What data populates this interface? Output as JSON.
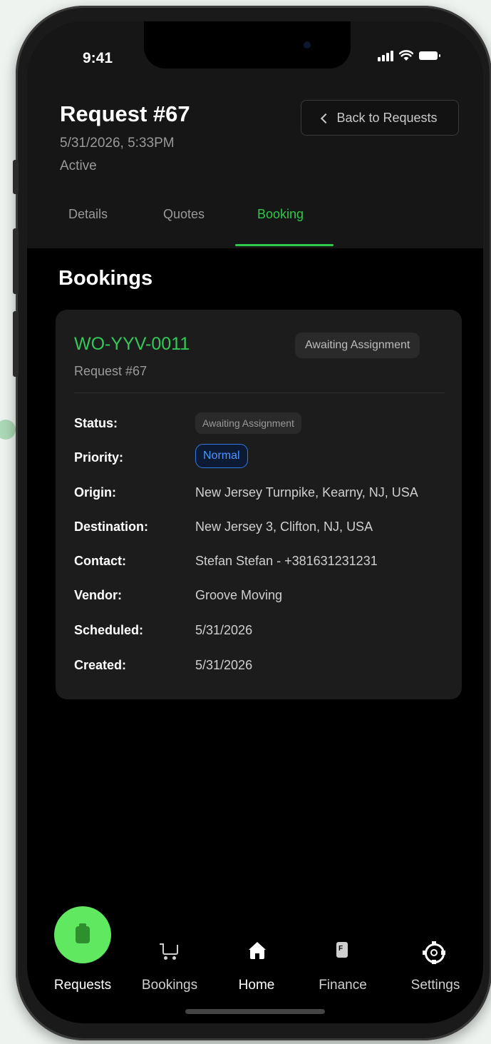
{
  "status_bar": {
    "time": "9:41"
  },
  "header": {
    "title": "Request #67",
    "datetime": "5/31/2026, 5:33PM",
    "status": "Active",
    "back_label": "Back to Requests"
  },
  "tabs": [
    {
      "label": "Details",
      "active": false
    },
    {
      "label": "Quotes",
      "active": false
    },
    {
      "label": "Booking",
      "active": true
    }
  ],
  "section": {
    "title": "Bookings"
  },
  "booking": {
    "id": "WO-YYV-0011",
    "request": "Request #67",
    "status_badge": "Awaiting Assignment",
    "fields": [
      {
        "label": "Status:",
        "value": "Awaiting Assignment",
        "kind": "badge"
      },
      {
        "label": "Priority:",
        "value": "Normal",
        "kind": "priority"
      },
      {
        "label": "Origin:",
        "value": "New Jersey Turnpike, Kearny, NJ, USA",
        "kind": "text"
      },
      {
        "label": "Destination:",
        "value": "New Jersey 3, Clifton, NJ, USA",
        "kind": "text"
      },
      {
        "label": "Contact:",
        "value": "Stefan Stefan - +381631231231",
        "kind": "text"
      },
      {
        "label": "Vendor:",
        "value": "Groove Moving",
        "kind": "text"
      },
      {
        "label": "Scheduled:",
        "value": "5/31/2026",
        "kind": "text"
      },
      {
        "label": "Created:",
        "value": "5/31/2026",
        "kind": "text"
      }
    ]
  },
  "bottom_nav": [
    {
      "label": "Requests",
      "icon": "clipboard-icon",
      "active": true
    },
    {
      "label": "Bookings",
      "icon": "cart-icon",
      "active": false
    },
    {
      "label": "Home",
      "icon": "home-icon",
      "active": false
    },
    {
      "label": "Finance",
      "icon": "document-icon",
      "active": false
    },
    {
      "label": "Settings",
      "icon": "gear-icon",
      "active": false
    }
  ],
  "colors": {
    "accent_green": "#2ec84a",
    "priority_blue": "#2f7be6"
  }
}
